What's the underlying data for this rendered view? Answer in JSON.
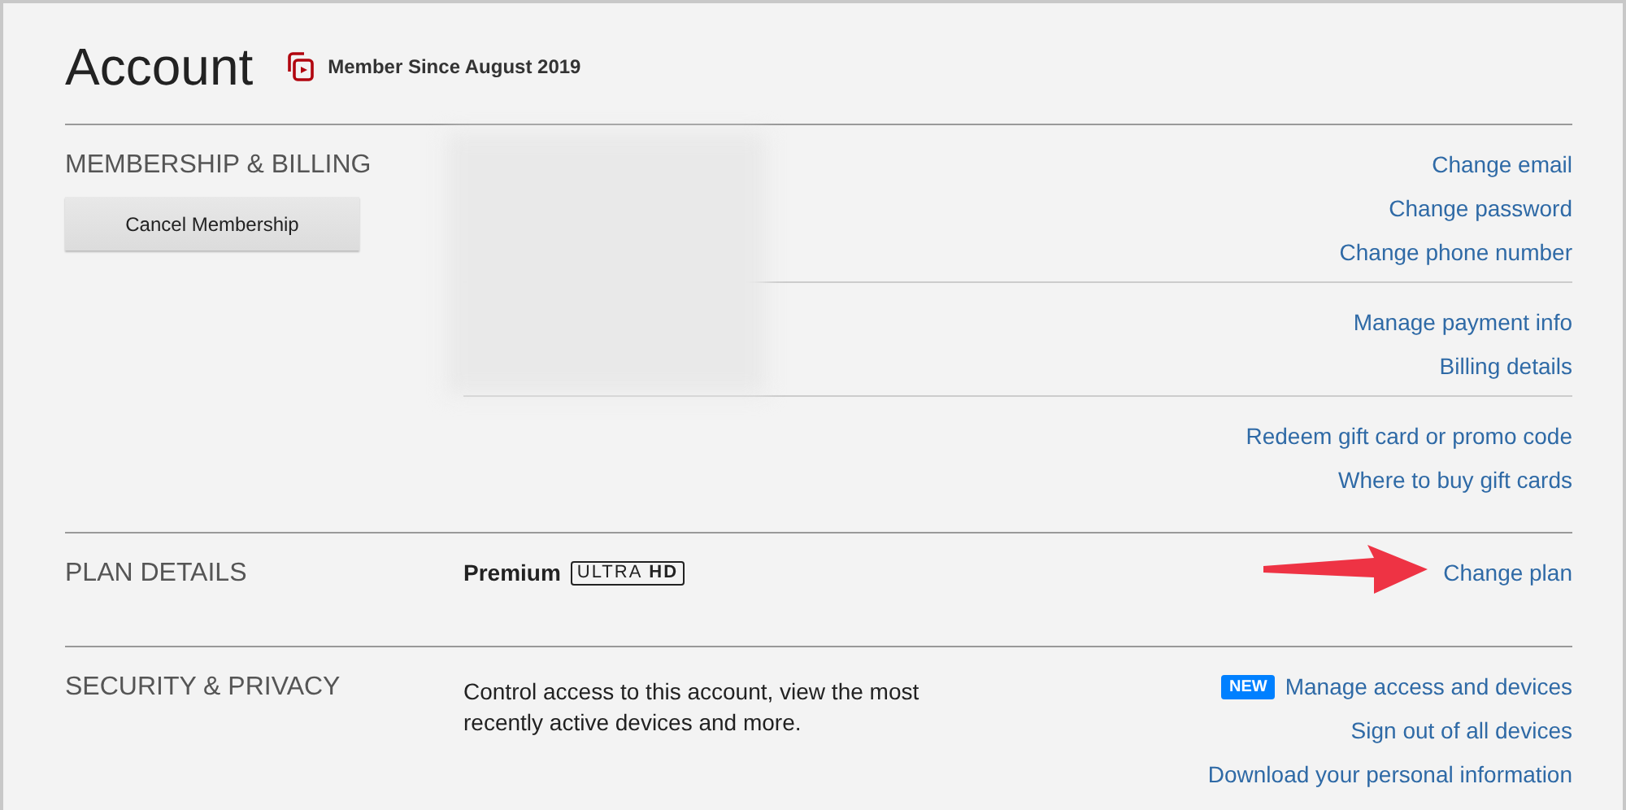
{
  "header": {
    "title": "Account",
    "member_since": "Member Since August 2019"
  },
  "sections": [
    {
      "kind": "membership",
      "label": "MEMBERSHIP & BILLING",
      "button": "Cancel Membership",
      "redacted": true,
      "link_groups": [
        [
          {
            "text": "Change email"
          },
          {
            "text": "Change password"
          },
          {
            "text": "Change phone number"
          }
        ],
        [
          {
            "text": "Manage payment info"
          },
          {
            "text": "Billing details"
          }
        ],
        [
          {
            "text": "Redeem gift card or promo code"
          },
          {
            "text": "Where to buy gift cards"
          }
        ]
      ]
    },
    {
      "kind": "plan",
      "label": "PLAN DETAILS",
      "plan": "Premium",
      "quality": "ULTRA",
      "quality_bold": "HD",
      "arrow": true,
      "link_groups": [
        [
          {
            "text": "Change plan"
          }
        ]
      ]
    },
    {
      "kind": "security",
      "label": "SECURITY & PRIVACY",
      "description": "Control access to this account, view the most recently active devices and more.",
      "link_groups": [
        [
          {
            "text": "Manage access and devices",
            "badge": "NEW"
          },
          {
            "text": "Sign out of all devices"
          },
          {
            "text": "Download your personal information"
          }
        ]
      ]
    }
  ]
}
